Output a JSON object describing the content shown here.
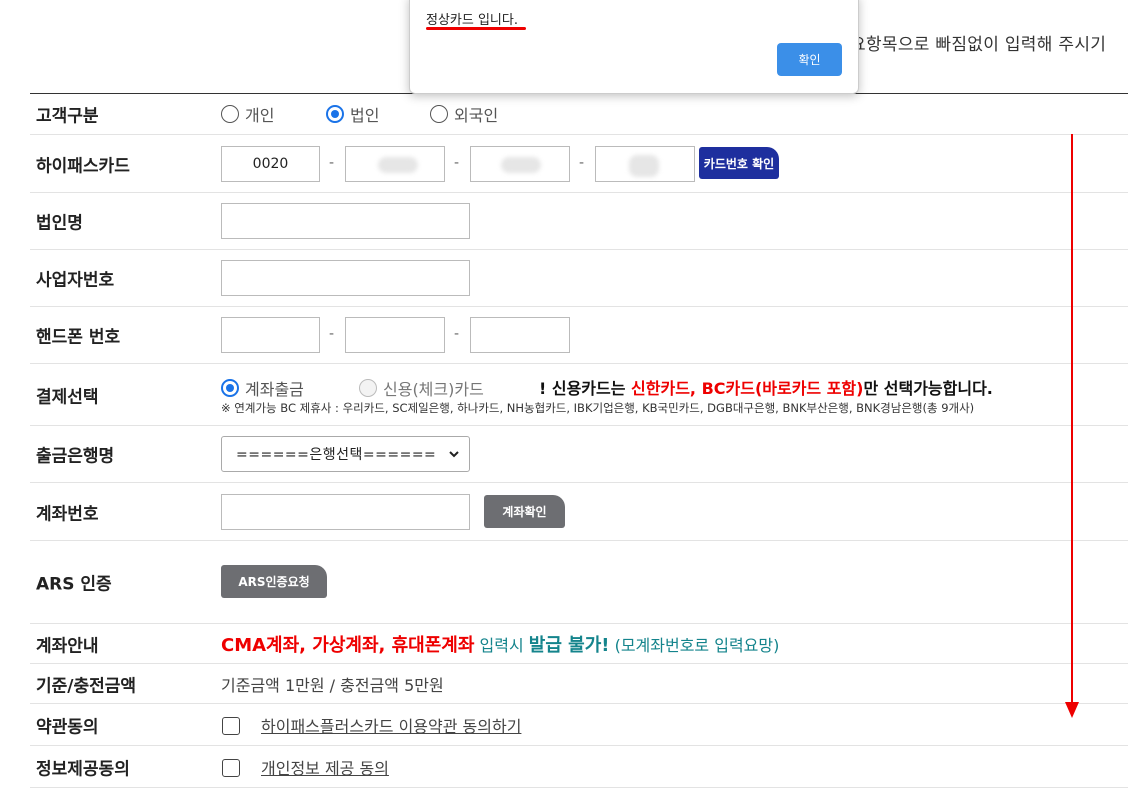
{
  "notice": "요항목으로 빠짐없이 입력해 주시기",
  "dialog": {
    "message": "정상카드 입니다.",
    "ok_label": "확인"
  },
  "form": {
    "customer_type": {
      "label": "고객구분",
      "options": [
        "개인",
        "법인",
        "외국인"
      ],
      "selected": "법인"
    },
    "hipass_card": {
      "label": "하이패스카드",
      "part1": "0020",
      "separator": "-",
      "verify_button": "카드번호 확인"
    },
    "corp_name": {
      "label": "법인명"
    },
    "biz_number": {
      "label": "사업자번호"
    },
    "phone": {
      "label": "핸드폰 번호",
      "separator": "-"
    },
    "payment": {
      "label": "결제선택",
      "option_account": "계좌출금",
      "option_card": "신용(체크)카드",
      "warn_prefix": "! 신용카드는 ",
      "warn_cards": "신한카드, BC카드(바로카드 포함)",
      "warn_suffix": "만 선택가능합니다.",
      "note": "※ 연계가능 BC 제휴사 : 우리카드, SC제일은행, 하나카드, NH농협카드, IBK기업은행, KB국민카드, DGB대구은행, BNK부산은행, BNK경남은행(총 9개사)"
    },
    "bank": {
      "label": "출금은행명",
      "selected": "======은행선택======"
    },
    "account": {
      "label": "계좌번호",
      "verify_button": "계좌확인"
    },
    "ars": {
      "label": "ARS 인증",
      "button": "ARS인증요청"
    },
    "account_info": {
      "label": "계좌안내",
      "red": "CMA계좌, 가상계좌, 휴대폰계좌",
      "t1": " 입력시 ",
      "bold": "발급 불가!",
      "t2": " (모계좌번호로 입력요망)"
    },
    "amount": {
      "label": "기준/충전금액",
      "text": "기준금액 1만원 / 충전금액 5만원"
    },
    "terms": {
      "label": "약관동의",
      "link": "하이패스플러스카드 이용약관 동의하기"
    },
    "privacy": {
      "label": "정보제공동의",
      "link": "개인정보 제공 동의"
    }
  },
  "colors": {
    "accent": "#1a73e8",
    "verify_button": "#1e2f9e",
    "gray_button": "#6d6e72",
    "warning_red": "#e00000",
    "teal": "#14848c",
    "annotation_arrow": "#e00000"
  }
}
